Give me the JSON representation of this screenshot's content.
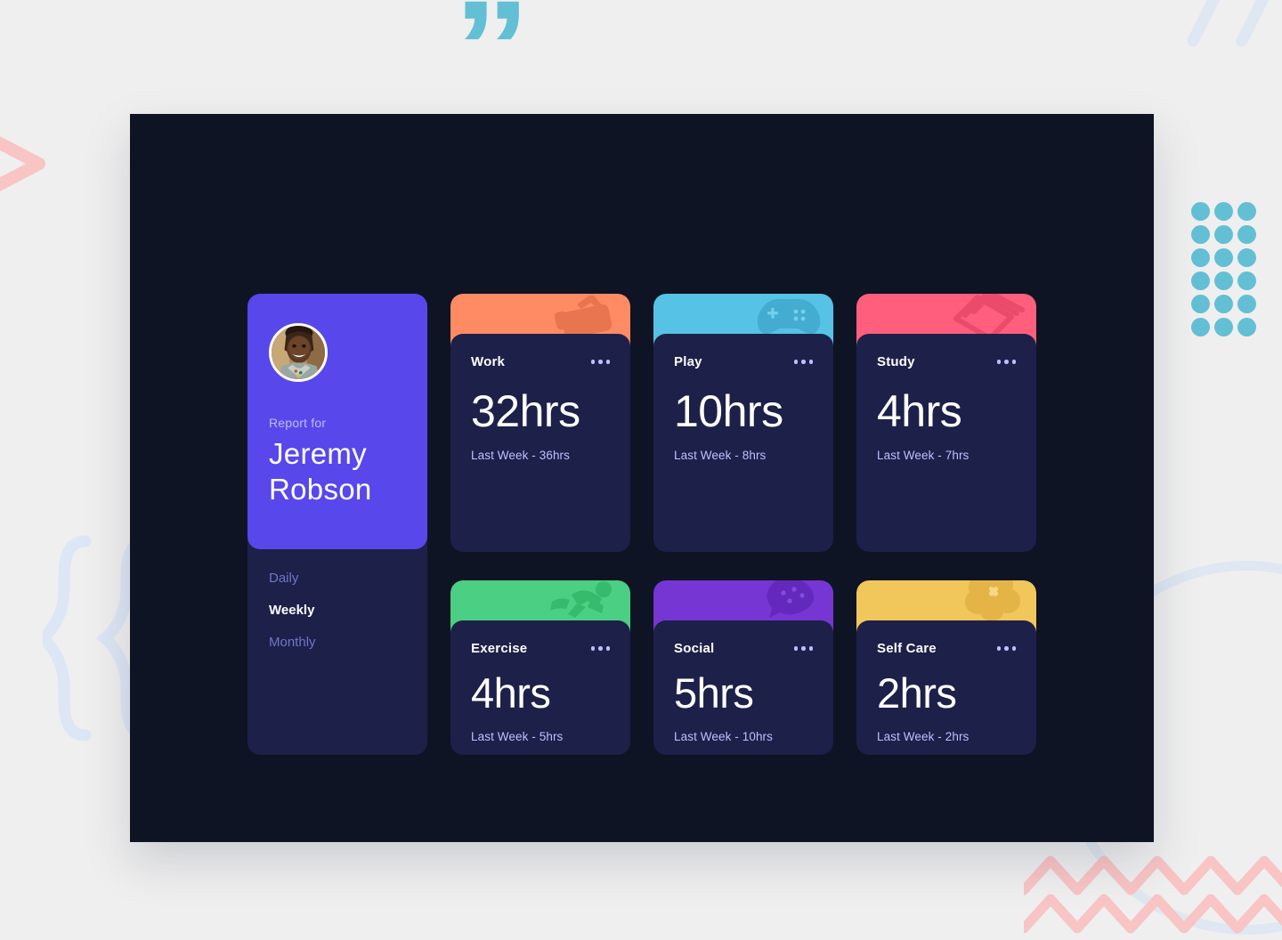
{
  "page": {
    "background_color": "#efefef",
    "panel_color": "#0f1424"
  },
  "profile": {
    "avatar_name": "avatar",
    "report_label": "Report for",
    "name": "Jeremy Robson",
    "accent_color": "#5847eb",
    "card_color": "#1d2049",
    "nav": [
      {
        "label": "Daily",
        "active": false
      },
      {
        "label": "Weekly",
        "active": true
      },
      {
        "label": "Monthly",
        "active": false
      }
    ]
  },
  "menu_icon": "ellipsis-icon",
  "cards": [
    {
      "title": "Work",
      "hours": "32hrs",
      "previous": "Last Week - 36hrs",
      "accent_color": "#ff8b64",
      "icon": "briefcase-icon",
      "size": "tall"
    },
    {
      "title": "Play",
      "hours": "10hrs",
      "previous": "Last Week - 8hrs",
      "accent_color": "#56c2e6",
      "icon": "game-controller-icon",
      "size": "tall"
    },
    {
      "title": "Study",
      "hours": "4hrs",
      "previous": "Last Week - 7hrs",
      "accent_color": "#ff5e7d",
      "icon": "book-icon",
      "size": "tall"
    },
    {
      "title": "Exercise",
      "hours": "4hrs",
      "previous": "Last Week - 5hrs",
      "accent_color": "#4bcf82",
      "icon": "running-person-icon",
      "size": "short"
    },
    {
      "title": "Social",
      "hours": "5hrs",
      "previous": "Last Week - 10hrs",
      "accent_color": "#7536d3",
      "icon": "chat-bubble-icon",
      "size": "short"
    },
    {
      "title": "Self Care",
      "hours": "2hrs",
      "previous": "Last Week - 2hrs",
      "accent_color": "#f1c65b",
      "icon": "flower-icon",
      "size": "short"
    }
  ],
  "decorations": {
    "quote_glyph": "”",
    "quote_color": "#63bfd4",
    "dots_color": "#63bfd4",
    "chevron_color": "#f9c4c4",
    "braces_color": "#dde6f4",
    "slashes_color": "#dee7f2",
    "circle_color": "#dee7f2",
    "zigzag_color": "#f9c4c4"
  }
}
